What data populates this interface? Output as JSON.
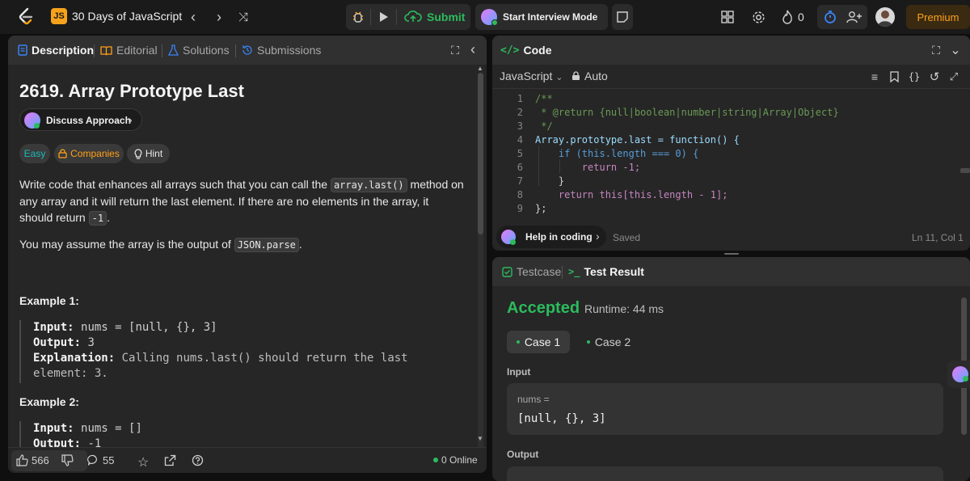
{
  "topbar": {
    "list_title": "30 Days of JavaScript",
    "js_badge": "JS",
    "submit_label": "Submit",
    "interview_label": "Start Interview Mode",
    "streak_count": "0",
    "premium_label": "Premium"
  },
  "description": {
    "tabs": [
      "Description",
      "Editorial",
      "Solutions",
      "Submissions"
    ],
    "title": "2619. Array Prototype Last",
    "discuss_label": "Discuss Approach",
    "tags": {
      "difficulty": "Easy",
      "companies": "Companies",
      "hint": "Hint"
    },
    "para1_a": "Write code that enhances all arrays such that you can call the ",
    "para1_code": "array.last()",
    "para1_b": " method on any array and it will return the last element. If there are no elements in the array, it should return ",
    "para1_code2": "-1",
    "para1_c": ".",
    "para2_a": "You may assume the array is the output of ",
    "para2_code": "JSON.parse",
    "para2_b": ".",
    "example1_title": "Example 1:",
    "example1": {
      "input_label": "Input:",
      "input": "nums = [null, {}, 3]",
      "output_label": "Output:",
      "output": "3",
      "expl_label": "Explanation:",
      "expl": "Calling nums.last() should return the last element: 3."
    },
    "example2_title": "Example 2:",
    "example2": {
      "input_label": "Input:",
      "input": "nums = []",
      "output_label": "Output:",
      "output": "-1"
    },
    "footer": {
      "likes": "566",
      "comments": "55",
      "online": "0 Online"
    }
  },
  "code": {
    "tab_label": "Code",
    "language": "JavaScript",
    "mode": "Auto",
    "lines": [
      "/**",
      " * @return {null|boolean|number|string|Array|Object}",
      " */",
      "Array.prototype.last = function() {",
      "    if (this.length === 0) {",
      "        return -1;",
      "    }",
      "    return this[this.length - 1];",
      "};"
    ],
    "help_label": "Help in coding",
    "saved_label": "Saved",
    "cursor": "Ln 11, Col 1"
  },
  "result": {
    "tabs": [
      "Testcase",
      "Test Result"
    ],
    "status": "Accepted",
    "runtime": "Runtime: 44 ms",
    "cases": [
      "Case 1",
      "Case 2"
    ],
    "input_label": "Input",
    "var_name": "nums =",
    "var_value": "[null, {}, 3]",
    "output_label": "Output"
  },
  "colors": {
    "accent_green": "#2cbb5d",
    "premium_orange": "#ffa116",
    "bg_panel": "#262626"
  }
}
